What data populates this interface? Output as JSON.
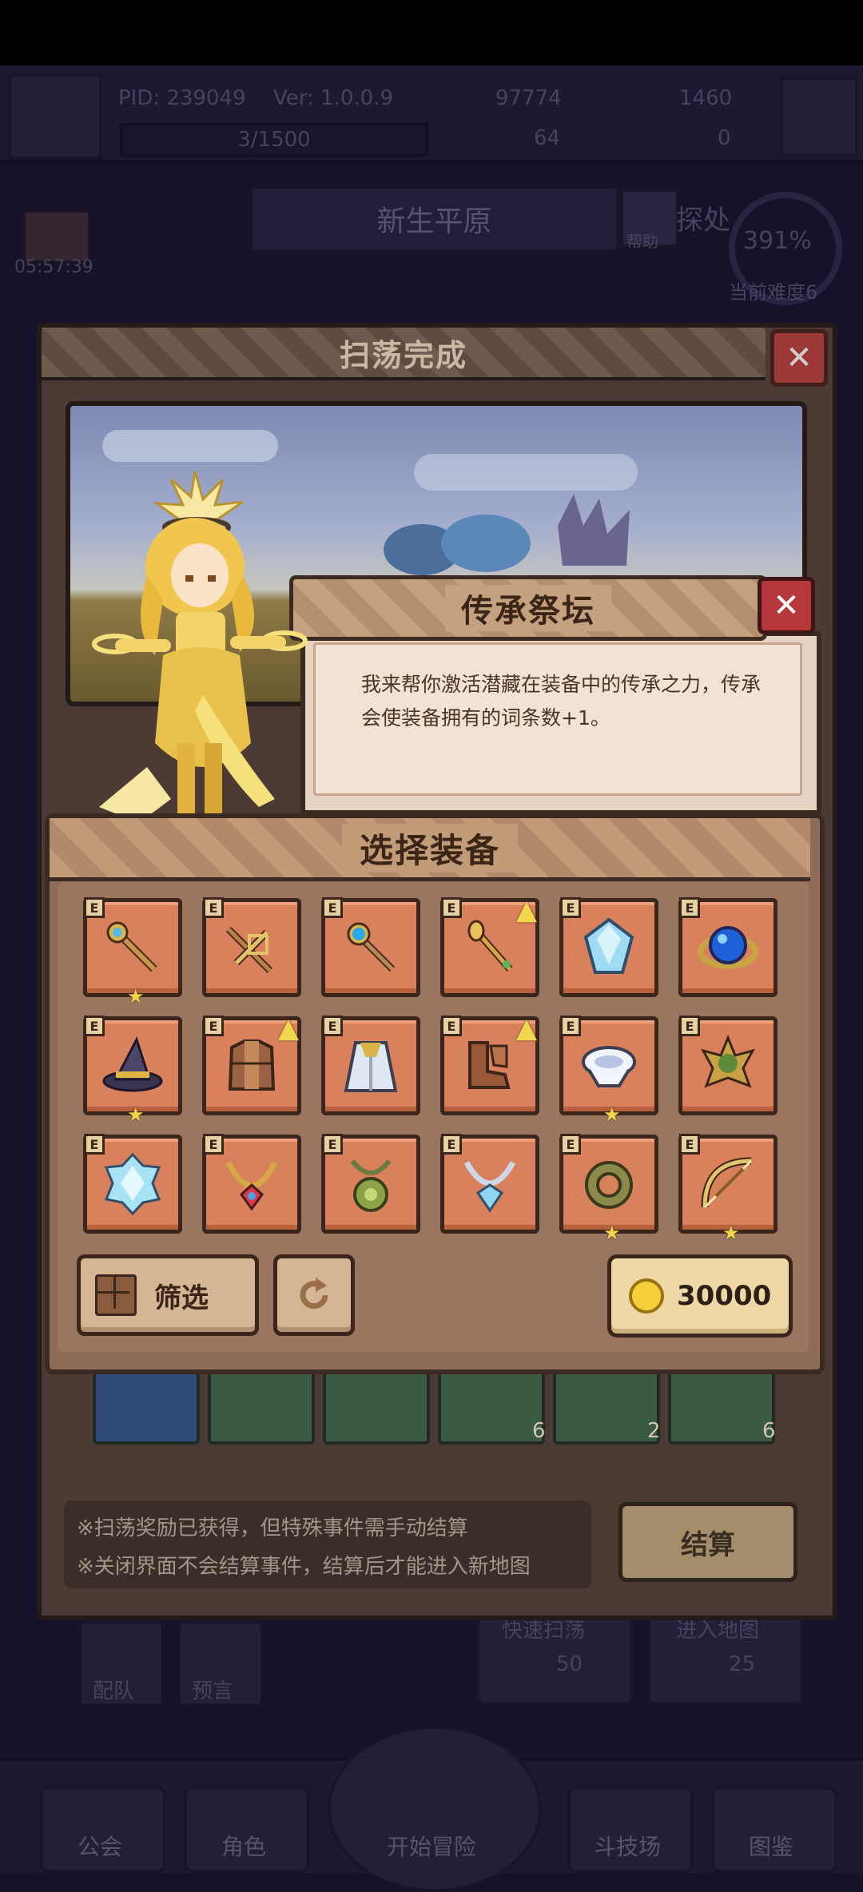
{
  "hud": {
    "pid": "PID: 239049",
    "version": "Ver: 1.0.0.9",
    "gold": "97774",
    "gems": "1460",
    "exp": "3/1500",
    "stat_a": "64",
    "stat_b": "0",
    "region": "新生平原",
    "help_label": "帮助",
    "explore_partial": "探处",
    "timer": "05:57:39",
    "percent": "391%",
    "difficulty": "当前难度6"
  },
  "sweep_panel": {
    "title": "扫荡完成",
    "close_glyph": "✕",
    "slot_counts": [
      "6",
      "2",
      "6"
    ],
    "notice_lines": [
      "※扫荡奖励已获得，但特殊事件需手动结算",
      "※关闭界面不会结算事件，结算后才能进入新地图"
    ],
    "settle_label": "结算"
  },
  "altar": {
    "title": "传承祭坛",
    "close_glyph": "✕",
    "description": "我来帮你激活潜藏在装备中的传承之力，传承会使装备拥有的词条数+1。"
  },
  "select_equipment": {
    "title": "选择装备",
    "tag_letter": "E",
    "items": [
      {
        "icon": "scepter-icon",
        "star": true,
        "upgrade": false
      },
      {
        "icon": "crossbow-icon",
        "star": false,
        "upgrade": false
      },
      {
        "icon": "orb-staff-icon",
        "star": false,
        "upgrade": false
      },
      {
        "icon": "golden-wand-icon",
        "star": false,
        "upgrade": true
      },
      {
        "icon": "crystal-shard-icon",
        "star": false,
        "upgrade": false
      },
      {
        "icon": "sapphire-ring-icon",
        "star": false,
        "upgrade": false
      },
      {
        "icon": "wizard-hat-icon",
        "star": true,
        "upgrade": false
      },
      {
        "icon": "leather-armor-icon",
        "star": false,
        "upgrade": true
      },
      {
        "icon": "silver-cape-icon",
        "star": false,
        "upgrade": false
      },
      {
        "icon": "leather-boots-icon",
        "star": false,
        "upgrade": true
      },
      {
        "icon": "white-gloves-icon",
        "star": true,
        "upgrade": false
      },
      {
        "icon": "jade-crown-icon",
        "star": false,
        "upgrade": false
      },
      {
        "icon": "ice-crystal-icon",
        "star": false,
        "upgrade": false
      },
      {
        "icon": "ruby-necklace-icon",
        "star": false,
        "upgrade": false
      },
      {
        "icon": "jade-amulet-icon",
        "star": false,
        "upgrade": false
      },
      {
        "icon": "diamond-necklace-icon",
        "star": false,
        "upgrade": false
      },
      {
        "icon": "jade-ring-icon",
        "star": true,
        "upgrade": false
      },
      {
        "icon": "golden-bow-icon",
        "star": true,
        "upgrade": false
      }
    ],
    "filter_label": "筛选",
    "cost": "30000"
  },
  "bottom_nav": {
    "items": [
      "公会",
      "角色",
      "开始冒险",
      "斗技场",
      "图鉴"
    ],
    "left_buttons": [
      "配队",
      "预言"
    ],
    "quick_sweep": "快速扫荡",
    "quick_sweep_cost": "50",
    "enter_map": "进入地图",
    "enter_map_cost": "25"
  },
  "colors": {
    "tile": "#d9805c",
    "frame": "#8e6c57",
    "close_red": "#b7383a",
    "coin": "#f6cf3c"
  }
}
